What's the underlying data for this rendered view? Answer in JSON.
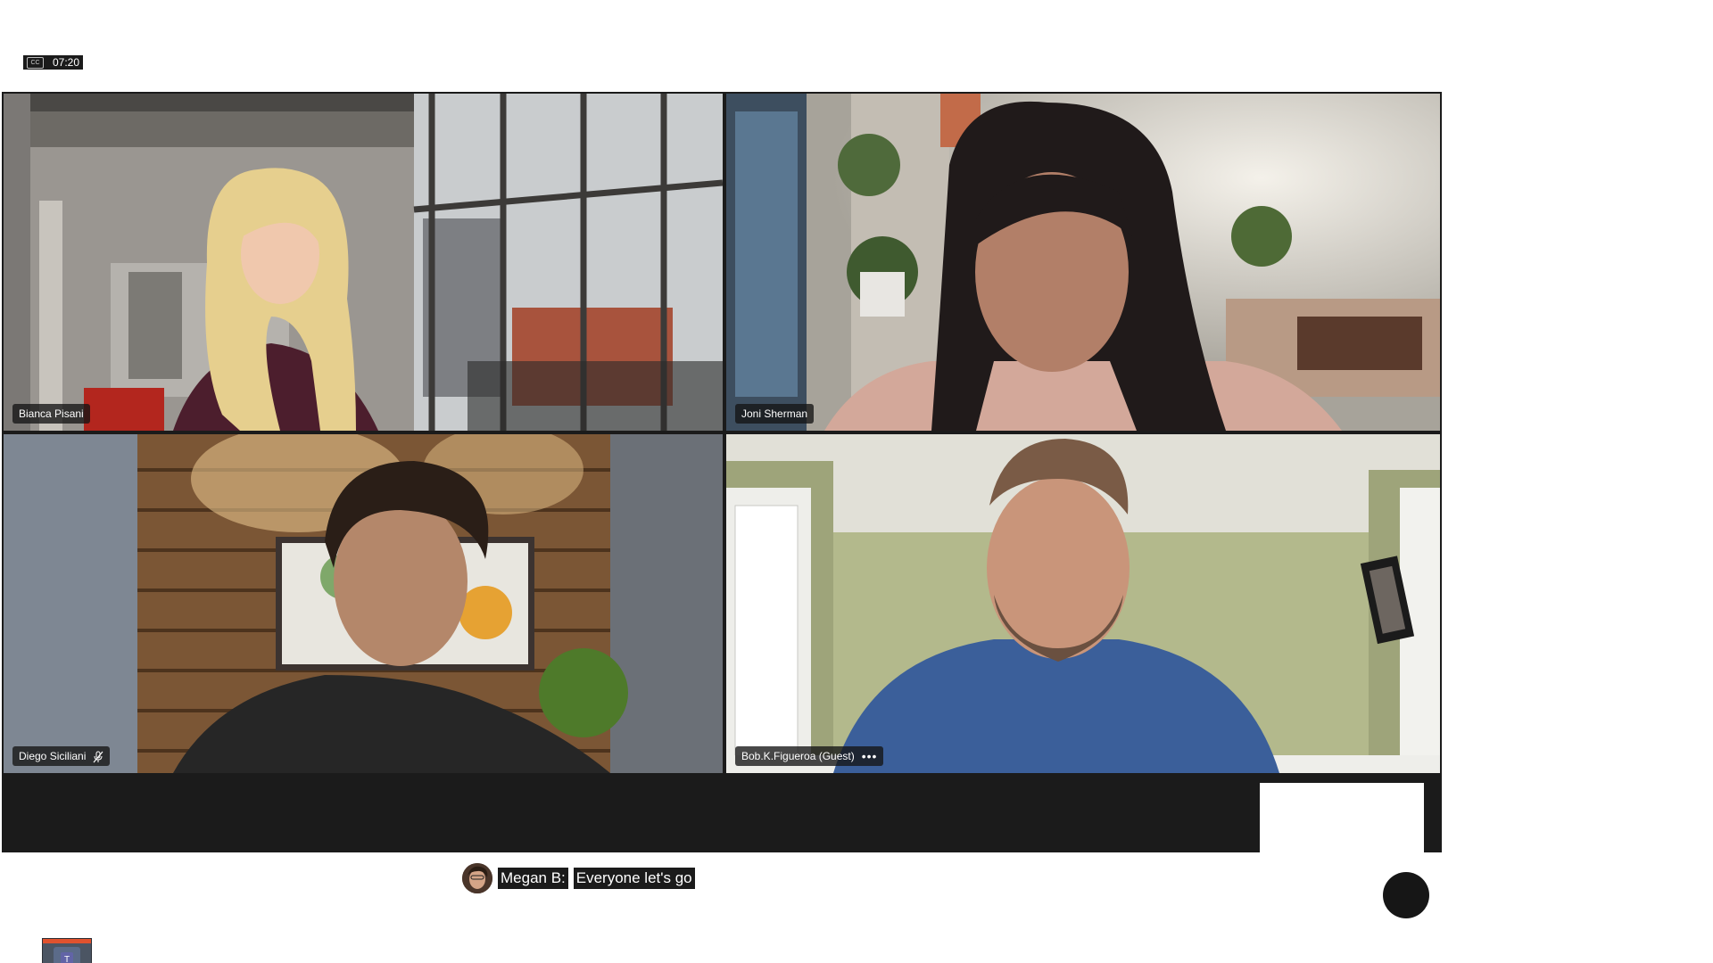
{
  "top_bar": {
    "cc_label": "CC",
    "elapsed_time": "07:20"
  },
  "participants": [
    {
      "name": "Bianca Pisani",
      "muted": false,
      "has_more_menu": false
    },
    {
      "name": "Joni Sherman",
      "muted": false,
      "has_more_menu": false
    },
    {
      "name": "Diego Siciliani",
      "muted": true,
      "has_more_menu": false
    },
    {
      "name": "Bob.K.Figueroa (Guest)",
      "muted": false,
      "has_more_menu": true
    }
  ],
  "participant_more_icon": "•••",
  "caption": {
    "speaker": "Megan B:",
    "text": "Everyone let's go"
  },
  "icons": {
    "cc": "closed-captions-icon",
    "mic_off": "mic-off-icon",
    "more": "more-options-icon",
    "taskbar": "teams-app-icon"
  },
  "colors": {
    "stage_bg": "#1b1b1b",
    "name_tag_bg": "#141414",
    "teams_purple": "#6264a7"
  }
}
